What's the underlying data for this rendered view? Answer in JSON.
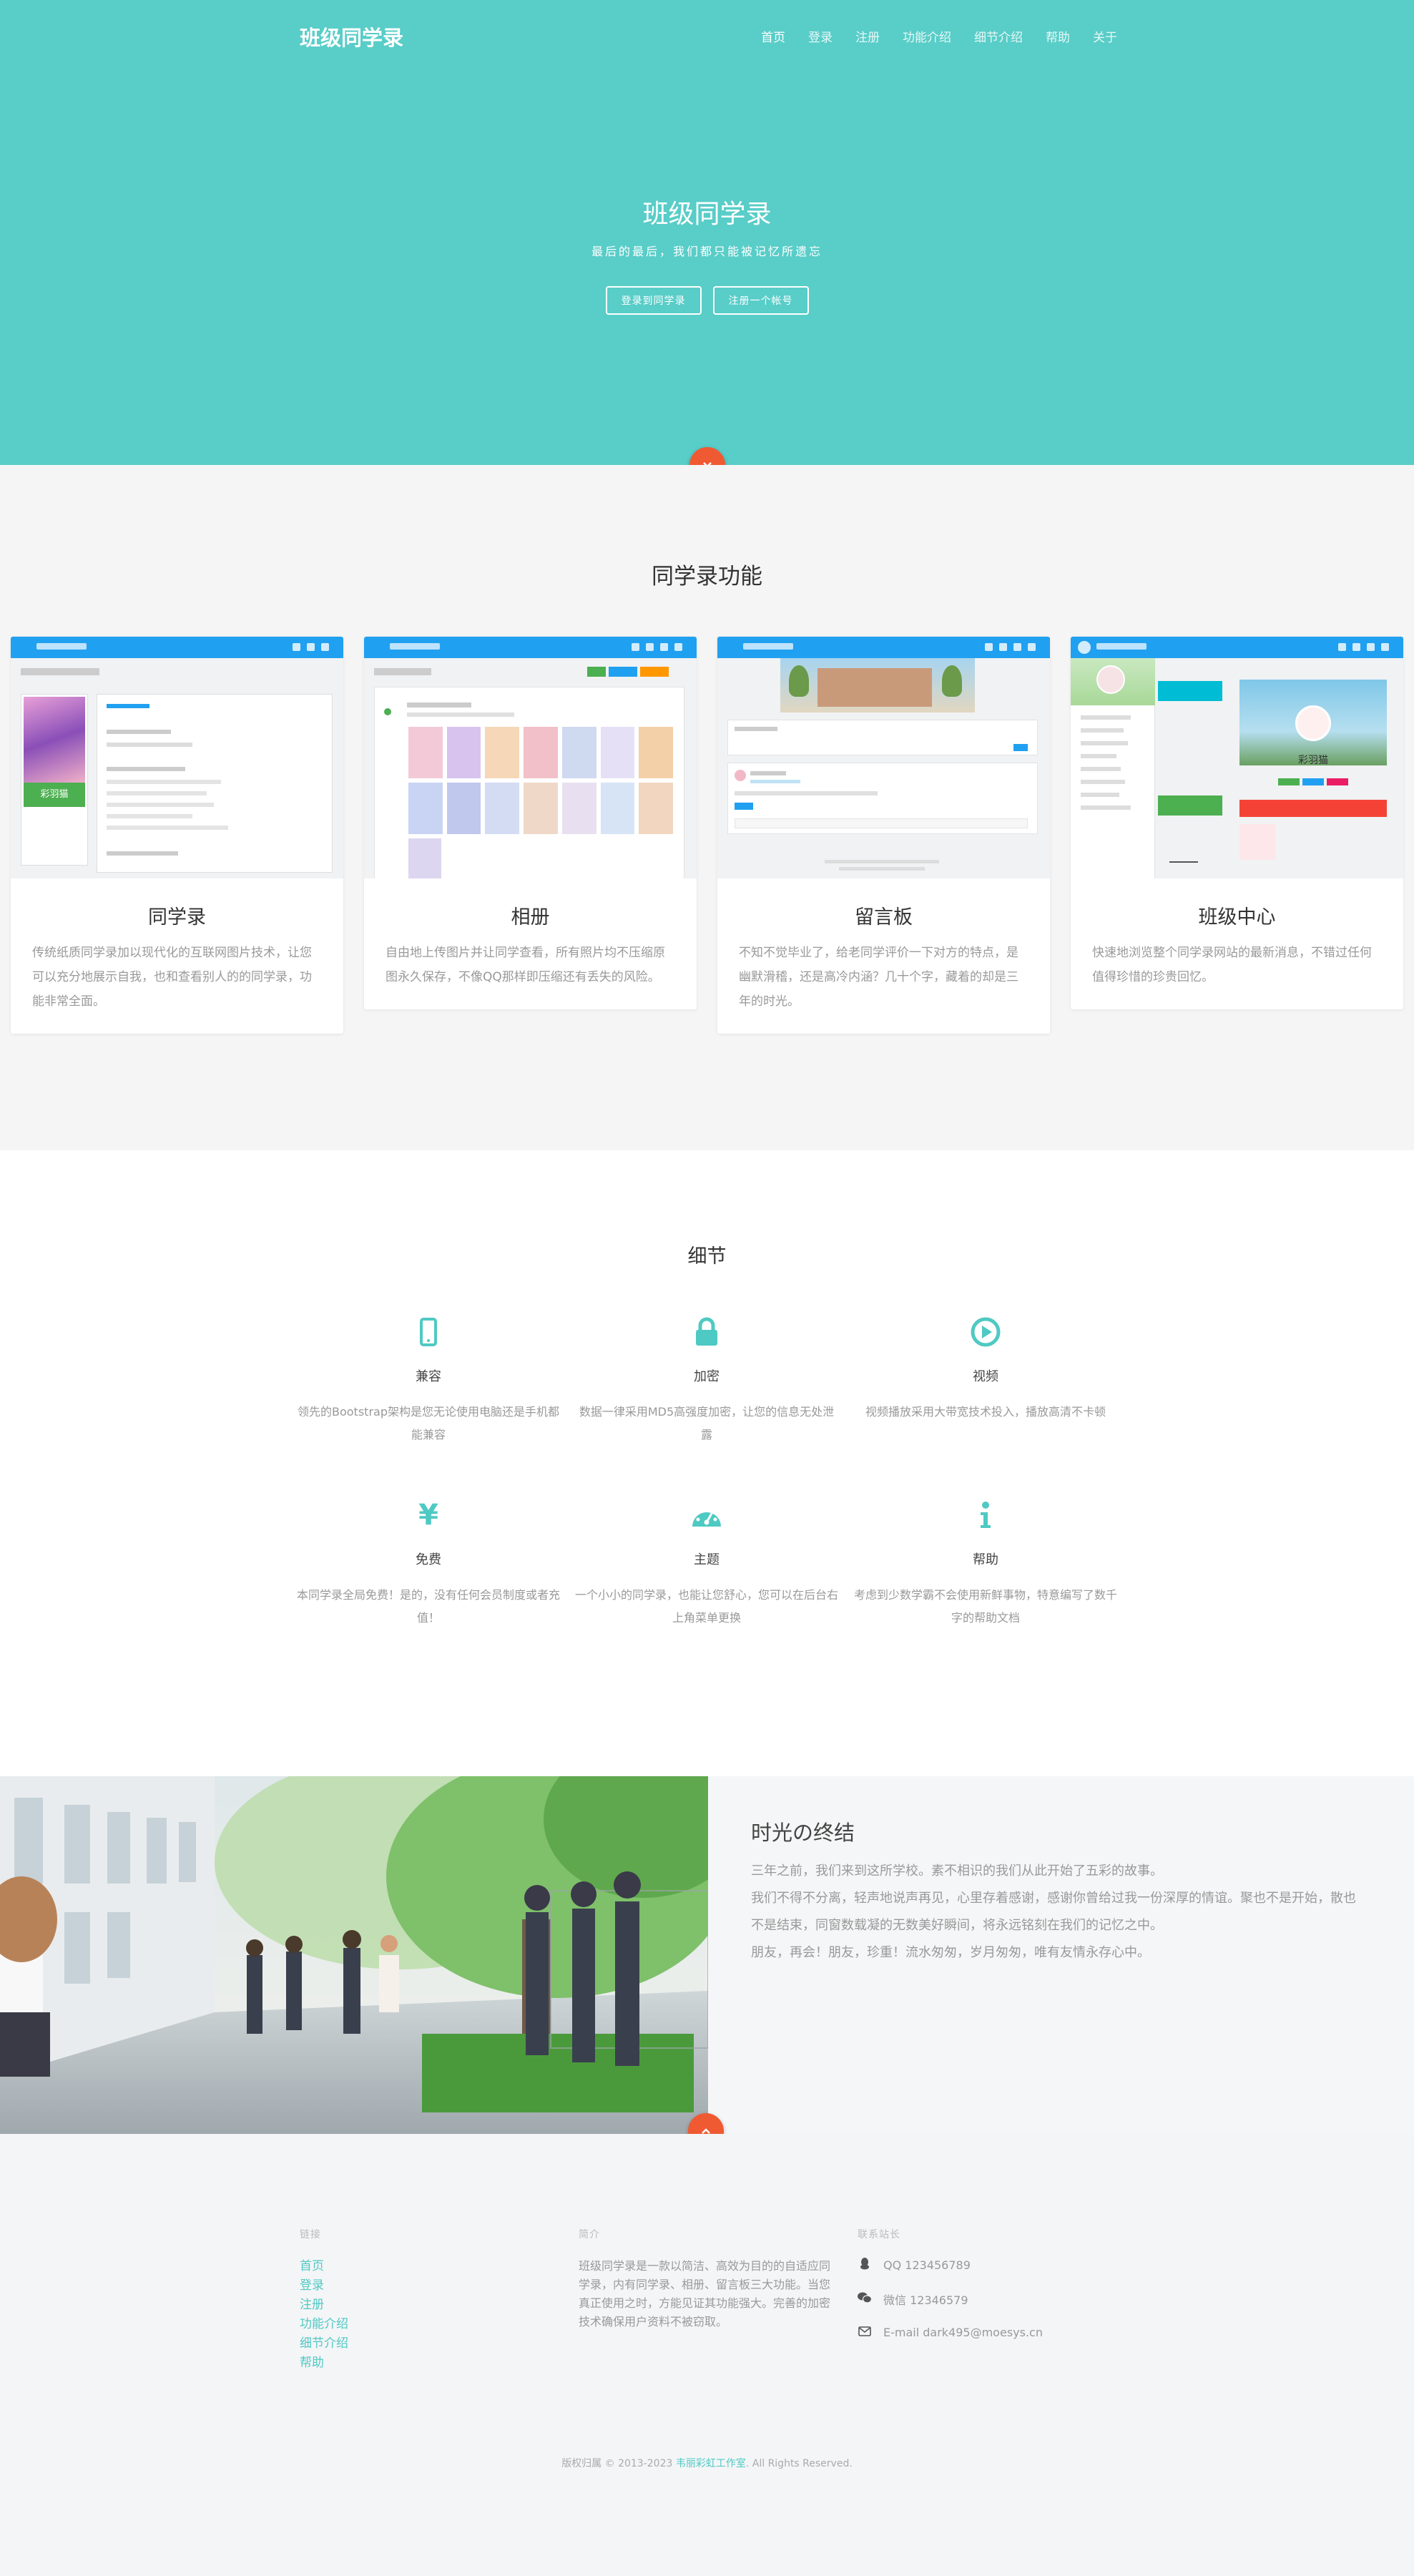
{
  "nav": {
    "brand": "班级同学录",
    "items": [
      "首页",
      "登录",
      "注册",
      "功能介绍",
      "细节介绍",
      "帮助",
      "关于"
    ]
  },
  "hero": {
    "title": "班级同学录",
    "subtitle": "最后的最后，我们都只能被记忆所遗忘",
    "login_button": "登录到同学录",
    "register_button": "注册一个帐号",
    "scroll_icon": "chevron-down-icon"
  },
  "features": {
    "title": "同学录功能",
    "cards": [
      {
        "title": "同学录",
        "desc": "传统纸质同学录加以现代化的互联网图片技术，让您可以充分地展示自我，也和查看别人的的同学录，功能非常全面。"
      },
      {
        "title": "相册",
        "desc": "自由地上传图片并让同学查看，所有照片均不压缩原图永久保存，不像QQ那样即压缩还有丢失的风险。"
      },
      {
        "title": "留言板",
        "desc": "不知不觉毕业了，给老同学评价一下对方的特点，是幽默滑稽，还是高冷内涵？几十个字，藏着的却是三年的时光。"
      },
      {
        "title": "班级中心",
        "desc": "快速地浏览整个同学录网站的最新消息，不错过任何值得珍惜的珍贵回忆。"
      }
    ],
    "shot_texts": {
      "profile_name": "彩羽猫",
      "center_name": "彩羽猫"
    }
  },
  "details": {
    "title": "细节",
    "items": [
      {
        "icon": "mobile-icon",
        "title": "兼容",
        "desc": "领先的Bootstrap架构是您无论使用电脑还是手机都能兼容"
      },
      {
        "icon": "lock-icon",
        "title": "加密",
        "desc": "数据一律采用MD5高强度加密，让您的信息无处泄露"
      },
      {
        "icon": "play-circle-icon",
        "title": "视频",
        "desc": "视频播放采用大带宽技术投入，播放高清不卡顿"
      },
      {
        "icon": "yen-icon",
        "title": "免费",
        "desc": "本同学录全局免费！是的，没有任何会员制度或者充值！"
      },
      {
        "icon": "dashboard-icon",
        "title": "主题",
        "desc": "一个小小的同学录，也能让您舒心，您可以在后台右上角菜单更换"
      },
      {
        "icon": "info-icon",
        "title": "帮助",
        "desc": "考虑到少数学霸不会使用新鲜事物，特意编写了数千字的帮助文档"
      }
    ]
  },
  "story": {
    "title": "时光の终结",
    "paragraphs": [
      "三年之前，我们来到这所学校。素不相识的我们从此开始了五彩的故事。",
      "我们不得不分离，轻声地说声再见，心里存着感谢，感谢你曾给过我一份深厚的情谊。聚也不是开始，散也不是结束，同窗数载凝的无数美好瞬间，将永远铭刻在我们的记忆之中。",
      "朋友，再会！朋友，珍重！流水匆匆，岁月匆匆，唯有友情永存心中。"
    ],
    "scroll_icon": "chevron-up-icon"
  },
  "footer": {
    "links_heading": "链接",
    "links": [
      "首页",
      "登录",
      "注册",
      "功能介绍",
      "细节介绍",
      "帮助"
    ],
    "about_heading": "简介",
    "about": "班级同学录是一款以简洁、高效为目的的自适应同学录，内有同学录、相册、留言板三大功能。当您真正使用之时，方能见证其功能强大。完善的加密技术确保用户资料不被窃取。",
    "contact_heading": "联系站长",
    "contacts": [
      {
        "icon": "qq-icon",
        "text": "QQ 123456789"
      },
      {
        "icon": "wechat-icon",
        "text": "微信 12346579"
      },
      {
        "icon": "mail-icon",
        "text": "E-mail dark495@moesys.cn"
      }
    ],
    "copyright_prefix": "版权归属 © 2013-2023 ",
    "copyright_link": "韦丽彩虹工作室",
    "copyright_suffix": ". All Rights Reserved."
  },
  "colors": {
    "accent": "#59cdc8",
    "icon": "#4fc9c3",
    "orange": "#f05a32",
    "shot_bar": "#20a0f0"
  }
}
